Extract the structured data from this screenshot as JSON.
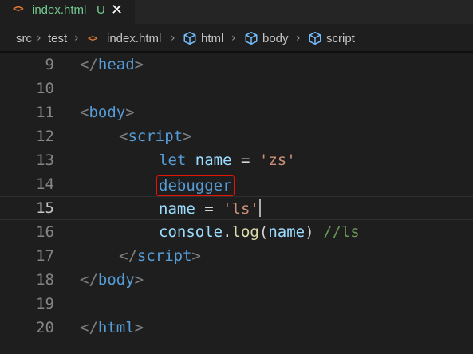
{
  "tab": {
    "icon": "html-file-icon",
    "icon_glyph": "<>",
    "filename": "index.html",
    "status": "U",
    "close_glyph": "✕"
  },
  "breadcrumb": {
    "items": [
      "src",
      "test",
      "index.html",
      "html",
      "body",
      "script"
    ],
    "separator": "›"
  },
  "editor": {
    "active_line": 15,
    "lines": [
      {
        "number": "9"
      },
      {
        "number": "10"
      },
      {
        "number": "11"
      },
      {
        "number": "12"
      },
      {
        "number": "13"
      },
      {
        "number": "14"
      },
      {
        "number": "15"
      },
      {
        "number": "16"
      },
      {
        "number": "17"
      },
      {
        "number": "18"
      },
      {
        "number": "19"
      },
      {
        "number": "20"
      }
    ],
    "tokens": {
      "lt": "<",
      "lt_slash": "</",
      "gt": ">",
      "head": "head",
      "body": "body",
      "script": "script",
      "html": "html",
      "let": "let",
      "name": "name",
      "eq": " = ",
      "zs": "'zs'",
      "debugger": "debugger",
      "ls": "'ls'",
      "console": "console",
      "dot": ".",
      "log": "log",
      "paren_open": "(",
      "paren_close": ")",
      "comment": "//ls"
    }
  },
  "colors": {
    "background": "#1e1e1e",
    "tab_text": "#73c991",
    "keyword": "#569cd6",
    "variable": "#9cdcfe",
    "string": "#ce9178",
    "function": "#dcdcaa",
    "comment": "#6a9955",
    "highlight_border": "#e51400"
  }
}
